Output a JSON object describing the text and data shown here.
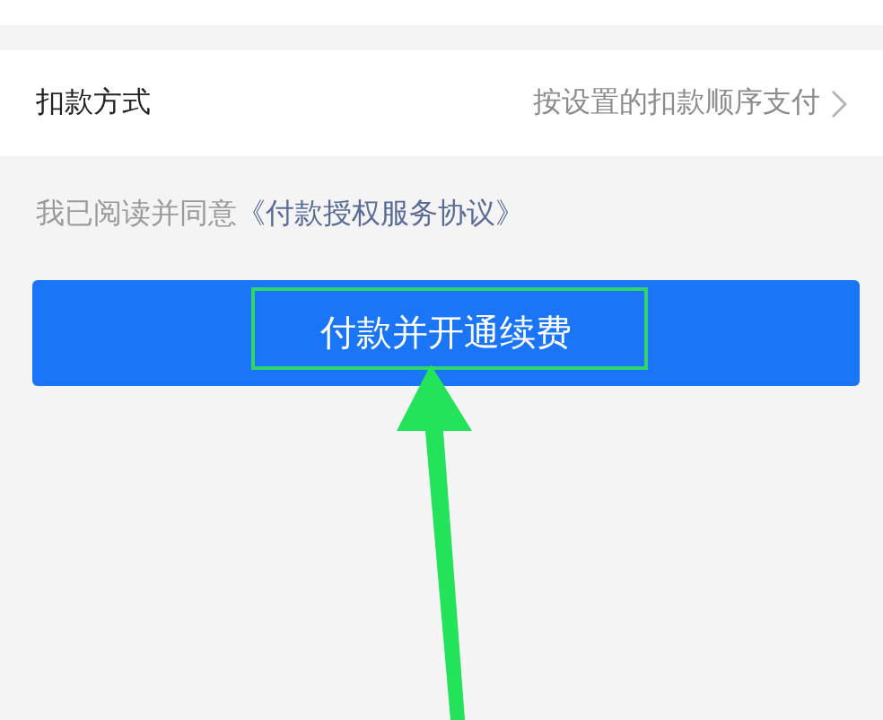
{
  "payment_method": {
    "label": "扣款方式",
    "value": "按设置的扣款顺序支付"
  },
  "agreement": {
    "text": "我已阅读并同意",
    "link": "《付款授权服务协议》"
  },
  "pay_button": {
    "label": "付款并开通续费"
  }
}
